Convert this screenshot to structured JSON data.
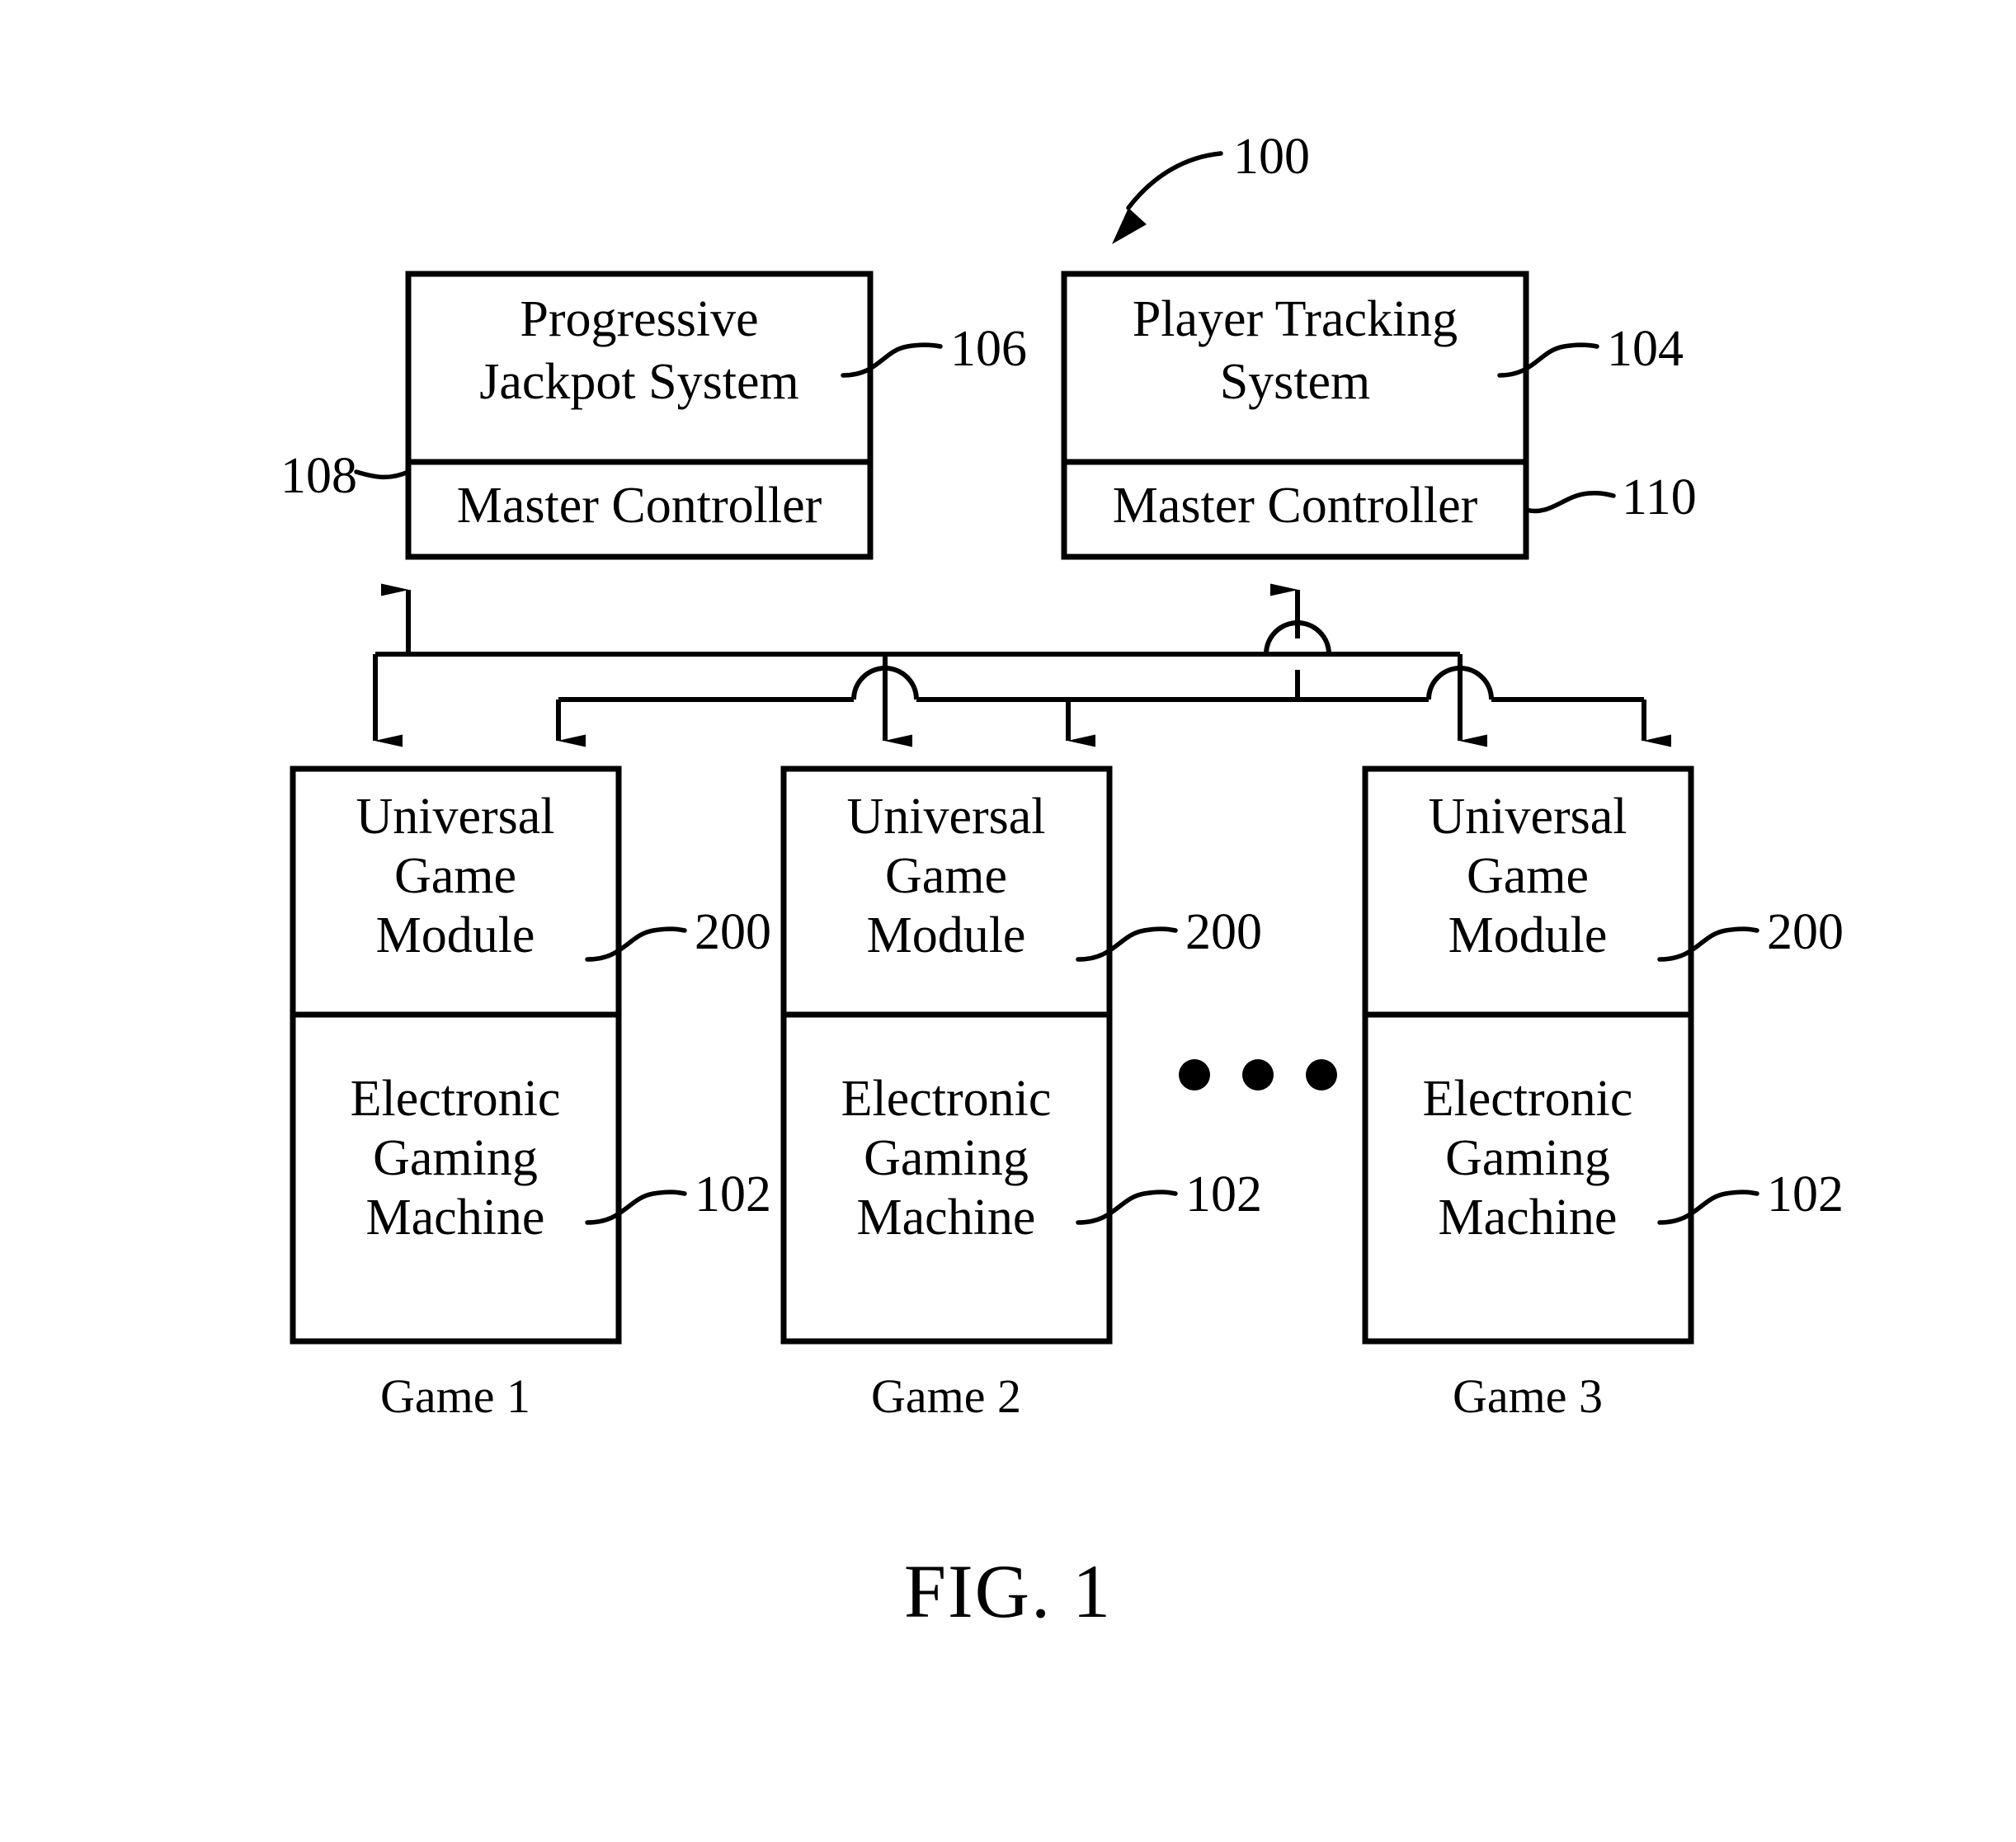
{
  "figure": {
    "caption": "FIG. 1",
    "system_ref": "100"
  },
  "top_systems": [
    {
      "id": "progressive-jackpot-system",
      "title_lines": [
        "Progressive",
        "Jackpot System"
      ],
      "ref": "106",
      "sub_title": "Master Controller",
      "sub_ref": "108",
      "sub_ref_side": "left"
    },
    {
      "id": "player-tracking-system",
      "title_lines": [
        "Player Tracking",
        "System"
      ],
      "ref": "104",
      "sub_title": "Master Controller",
      "sub_ref": "110",
      "sub_ref_side": "right"
    }
  ],
  "games": [
    {
      "id": "game-1",
      "label": "Game 1",
      "module_lines": [
        "Universal",
        "Game",
        "Module"
      ],
      "module_ref": "200",
      "machine_lines": [
        "Electronic",
        "Gaming",
        "Machine"
      ],
      "machine_ref": "102"
    },
    {
      "id": "game-2",
      "label": "Game 2",
      "module_lines": [
        "Universal",
        "Game",
        "Module"
      ],
      "module_ref": "200",
      "machine_lines": [
        "Electronic",
        "Gaming",
        "Machine"
      ],
      "machine_ref": "102"
    },
    {
      "id": "game-3",
      "label": "Game 3",
      "module_lines": [
        "Universal",
        "Game",
        "Module"
      ],
      "module_ref": "200",
      "machine_lines": [
        "Electronic",
        "Gaming",
        "Machine"
      ],
      "machine_ref": "102"
    }
  ],
  "ellipsis": "• • •",
  "colors": {
    "ink": "#000000",
    "paper": "#ffffff"
  }
}
